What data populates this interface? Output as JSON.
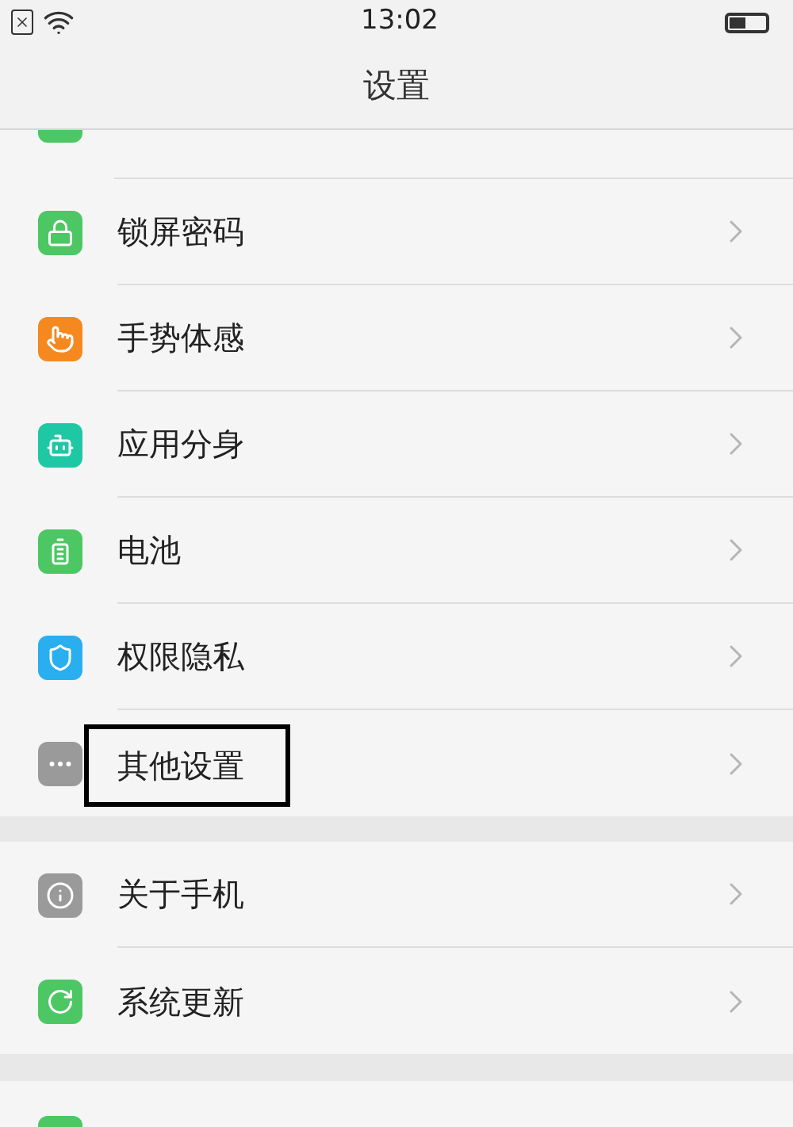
{
  "status_bar": {
    "time": "13:02"
  },
  "header": {
    "title": "设置"
  },
  "sections": [
    {
      "items": [
        {
          "label": "锁屏密码",
          "kind": "lock",
          "color": "#4cc764",
          "highlighted": false
        },
        {
          "label": "手势体感",
          "kind": "hand",
          "color": "#f5891f",
          "highlighted": false
        },
        {
          "label": "应用分身",
          "kind": "robot",
          "color": "#1fc8a4",
          "highlighted": false
        },
        {
          "label": "电池",
          "kind": "battery",
          "color": "#4cc764",
          "highlighted": false
        },
        {
          "label": "权限隐私",
          "kind": "shield",
          "color": "#29aef0",
          "highlighted": false
        },
        {
          "label": "其他设置",
          "kind": "more",
          "color": "#9a9a9a",
          "highlighted": true
        }
      ]
    },
    {
      "items": [
        {
          "label": "关于手机",
          "kind": "info",
          "color": "#9a9a9a",
          "highlighted": false
        },
        {
          "label": "系统更新",
          "kind": "update",
          "color": "#4cc764",
          "highlighted": false
        }
      ]
    }
  ]
}
